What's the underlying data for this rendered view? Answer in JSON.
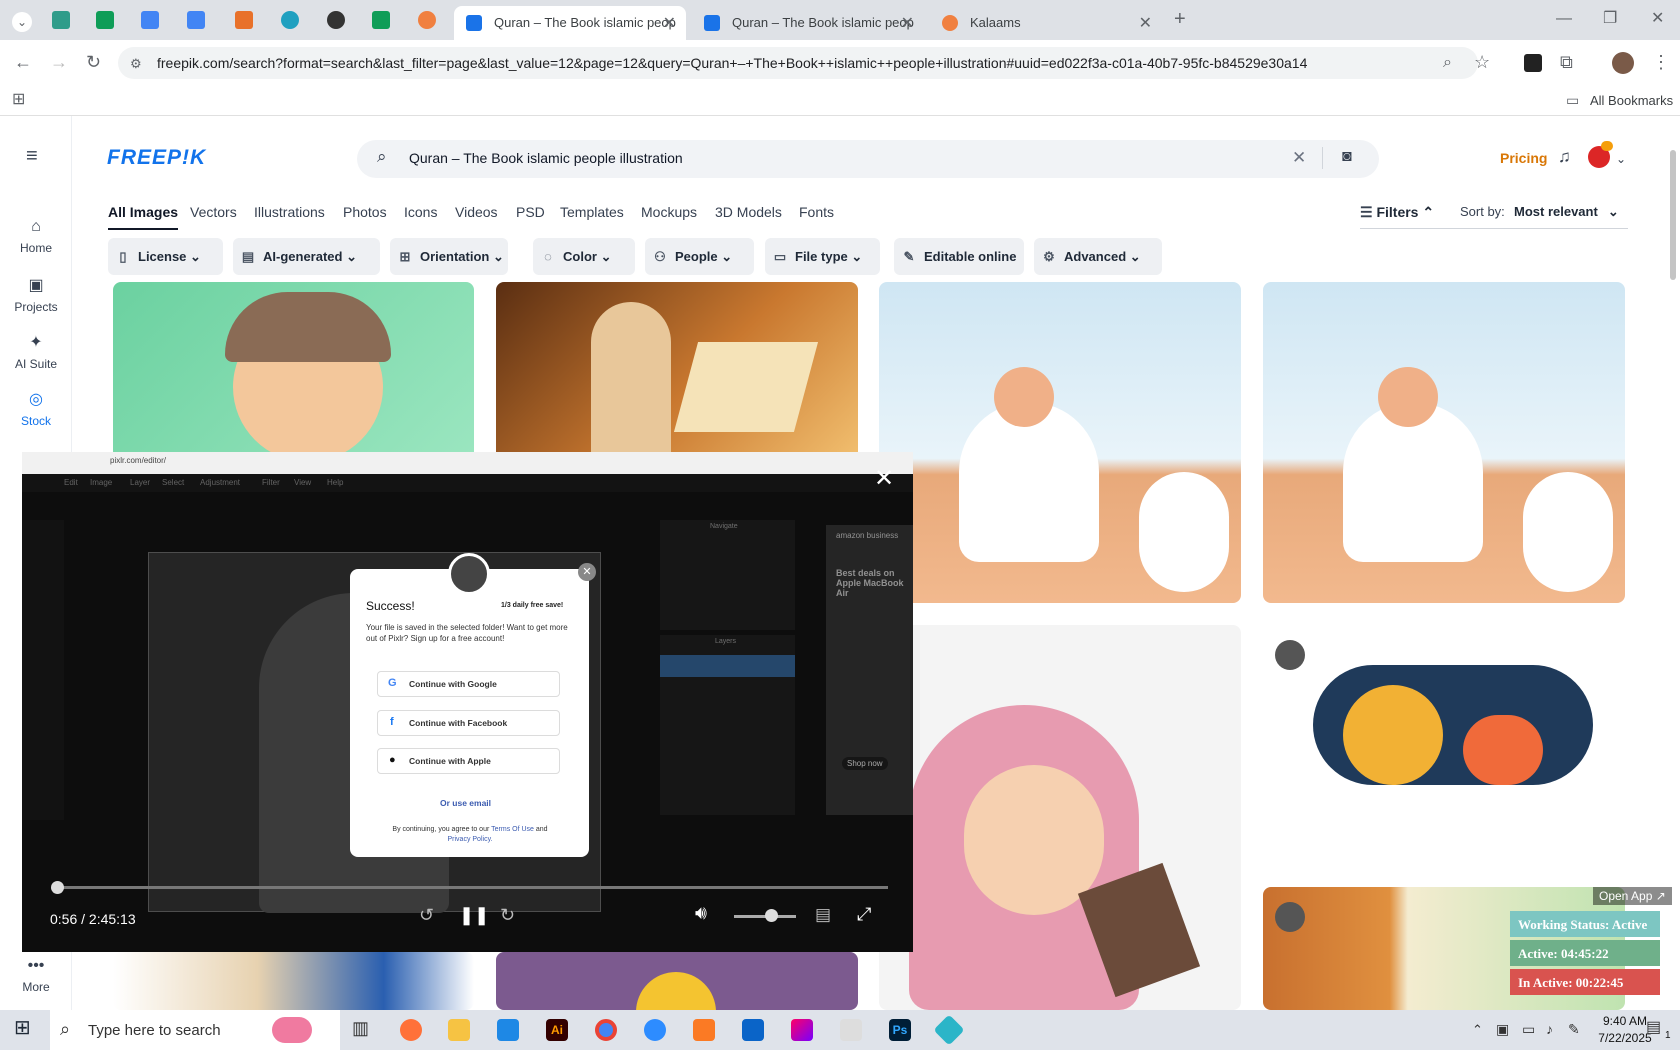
{
  "browser": {
    "tabs": [
      {
        "label": "Quran – The Book islamic peop"
      },
      {
        "label": "Quran – The Book islamic peop"
      },
      {
        "label": "Kalaams"
      }
    ],
    "url": "freepik.com/search?format=search&last_filter=page&last_value=12&page=12&query=Quran+–+The+Book++islamic++people+illustration#uuid=ed022f3a-c01a-40b7-95fc-b84529e30a14",
    "bookmarks_label": "All Bookmarks"
  },
  "freepik": {
    "logo": "FREEP!K",
    "search_value": "Quran – The Book  islamic  people illustration",
    "pricing": "Pricing",
    "sidebar": [
      {
        "label": "Home",
        "icon": "home-icon",
        "glyph": "⌂"
      },
      {
        "label": "Projects",
        "icon": "folder-icon",
        "glyph": "▣"
      },
      {
        "label": "AI Suite",
        "icon": "sparkle-icon",
        "glyph": "✦"
      },
      {
        "label": "Stock",
        "icon": "stock-icon",
        "glyph": "◎"
      },
      {
        "label": "More",
        "icon": "more-icon",
        "glyph": "•••"
      }
    ],
    "categories": [
      "All Images",
      "Vectors",
      "Illustrations",
      "Photos",
      "Icons",
      "Videos",
      "PSD",
      "Templates",
      "Mockups",
      "3D Models",
      "Fonts"
    ],
    "filters_label": "Filters",
    "sort_label": "Sort by:",
    "sort_value": "Most relevant",
    "filter_buttons": [
      "License",
      "AI-generated",
      "Orientation",
      "Color",
      "People",
      "File type",
      "Editable online",
      "Advanced"
    ]
  },
  "video": {
    "pixlr_url": "pixlr.com/editor/",
    "menu": [
      "Edit",
      "Image",
      "Layer",
      "Select",
      "Adjustment",
      "Filter",
      "View",
      "Help"
    ],
    "panel_navigate": "Navigate",
    "panel_layers": "Layers",
    "ad_brand": "amazon business",
    "ad_text": "Best deals on Apple MacBook Air",
    "ad_button": "Shop now",
    "dialog": {
      "title": "Success!",
      "badge": "1/3 daily free save!",
      "message": "Your file is saved in the selected folder! Want to get more out of Pixlr? Sign up for a free account!",
      "google": "Continue with Google",
      "facebook": "Continue with Facebook",
      "apple": "Continue with Apple",
      "email": "Or use email",
      "terms_prefix": "By continuing, you agree to our",
      "terms": "Terms Of Use",
      "and": "and",
      "privacy": "Privacy Policy."
    },
    "time": "0:56 / 2:45:13",
    "progress_fraction": 0.006,
    "volume_fraction": 0.6
  },
  "work_status": {
    "open_app": "Open App ↗",
    "status": "Working Status: Active",
    "active": "Active: 04:45:22",
    "inactive": "In Active: 00:22:45"
  },
  "taskbar": {
    "search_placeholder": "Type here to search",
    "time": "9:40 AM",
    "date": "7/22/2025",
    "notifications": "1"
  },
  "colors": {
    "brand": "#1273eb",
    "pricing": "#d97706",
    "status_green": "#6fb08a",
    "status_red": "#d9534f"
  }
}
